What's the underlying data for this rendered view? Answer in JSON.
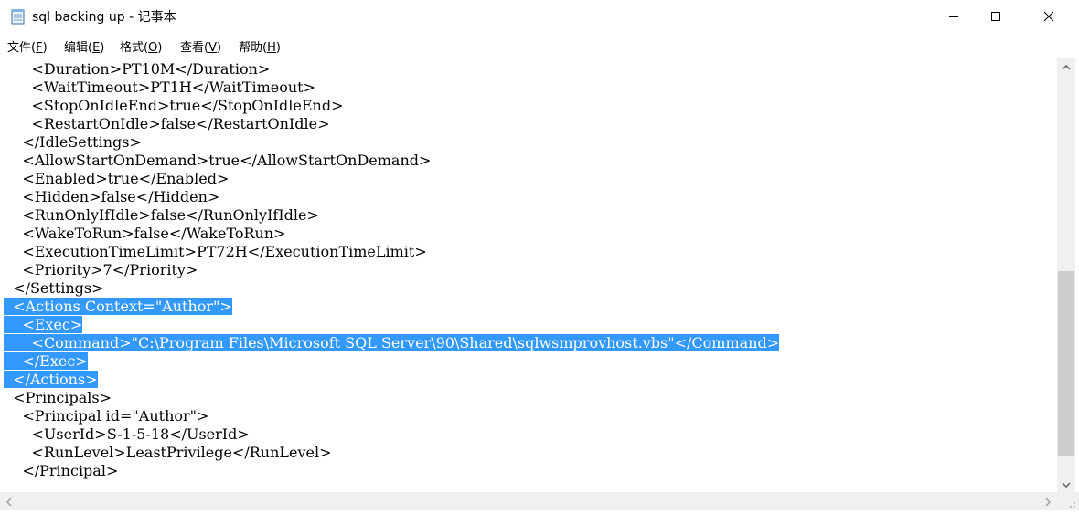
{
  "window": {
    "title": "sql backing up - 记事本"
  },
  "menu": [
    {
      "label": "文件(",
      "accel": "F",
      "tail": ")"
    },
    {
      "label": "编辑(",
      "accel": "E",
      "tail": ")"
    },
    {
      "label": "格式(",
      "accel": "O",
      "tail": ")"
    },
    {
      "label": "查看(",
      "accel": "V",
      "tail": ")"
    },
    {
      "label": "帮助(",
      "accel": "H",
      "tail": ")"
    }
  ],
  "lines": [
    {
      "indent": "      ",
      "text": "<Duration>PT10M</Duration>",
      "selected": false
    },
    {
      "indent": "      ",
      "text": "<WaitTimeout>PT1H</WaitTimeout>",
      "selected": false
    },
    {
      "indent": "      ",
      "text": "<StopOnIdleEnd>true</StopOnIdleEnd>",
      "selected": false
    },
    {
      "indent": "      ",
      "text": "<RestartOnIdle>false</RestartOnIdle>",
      "selected": false
    },
    {
      "indent": "    ",
      "text": "</IdleSettings>",
      "selected": false
    },
    {
      "indent": "    ",
      "text": "<AllowStartOnDemand>true</AllowStartOnDemand>",
      "selected": false
    },
    {
      "indent": "    ",
      "text": "<Enabled>true</Enabled>",
      "selected": false
    },
    {
      "indent": "    ",
      "text": "<Hidden>false</Hidden>",
      "selected": false
    },
    {
      "indent": "    ",
      "text": "<RunOnlyIfIdle>false</RunOnlyIfIdle>",
      "selected": false
    },
    {
      "indent": "    ",
      "text": "<WakeToRun>false</WakeToRun>",
      "selected": false
    },
    {
      "indent": "    ",
      "text": "<ExecutionTimeLimit>PT72H</ExecutionTimeLimit>",
      "selected": false
    },
    {
      "indent": "    ",
      "text": "<Priority>7</Priority>",
      "selected": false
    },
    {
      "indent": "  ",
      "text": "</Settings>",
      "selected": false
    },
    {
      "indent": "  ",
      "text": "<Actions Context=\"Author\">",
      "selected": true
    },
    {
      "indent": "    ",
      "text": "<Exec>",
      "selected": true
    },
    {
      "indent": "      ",
      "text": "<Command>\"C:\\Program Files\\Microsoft SQL Server\\90\\Shared\\sqlwsmprovhost.vbs\"</Command>",
      "selected": true
    },
    {
      "indent": "    ",
      "text": "</Exec>",
      "selected": true
    },
    {
      "indent": "  ",
      "text": "</Actions>",
      "selected": true
    },
    {
      "indent": "  ",
      "text": "<Principals>",
      "selected": false
    },
    {
      "indent": "    ",
      "text": "<Principal id=\"Author\">",
      "selected": false
    },
    {
      "indent": "      ",
      "text": "<UserId>S-1-5-18</UserId>",
      "selected": false
    },
    {
      "indent": "      ",
      "text": "<RunLevel>LeastPrivilege</RunLevel>",
      "selected": false
    },
    {
      "indent": "    ",
      "text": "</Principal>",
      "selected": false
    }
  ],
  "colors": {
    "selection": "#3399ff",
    "scroll_track": "#f0f0f0",
    "scroll_thumb": "#cdcdcd"
  },
  "icons": {
    "app": "notepad-icon",
    "minimize": "minimize-icon",
    "maximize": "maximize-icon",
    "close": "close-icon"
  }
}
